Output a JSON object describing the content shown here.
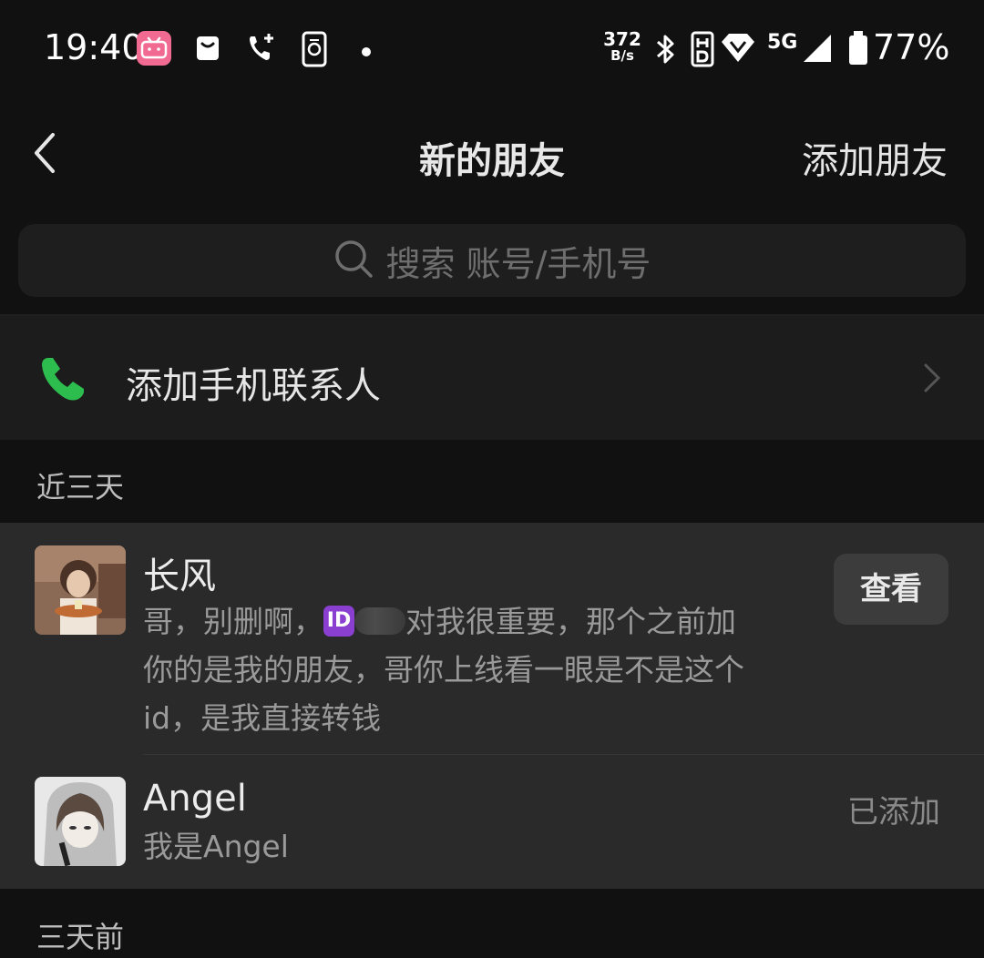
{
  "status_bar": {
    "time": "19:40",
    "apps": [
      "bilibili-icon",
      "shopping-bag-icon",
      "call-forward-icon",
      "phone-sync-icon"
    ],
    "net_speed_value": "372",
    "net_speed_unit": "B/s",
    "network": "5G",
    "battery": "77%"
  },
  "header": {
    "title": "新的朋友",
    "action": "添加朋友"
  },
  "search": {
    "placeholder": "搜索 账号/手机号"
  },
  "add_contacts": {
    "label": "添加手机联系人",
    "icon_color": "#2dbd4e"
  },
  "sections": {
    "recent": "近三天",
    "older": "三天前"
  },
  "requests": [
    {
      "name": "长风",
      "message_before": "哥，别删啊，",
      "badge": "ID",
      "message_after": "对我很重要，那个之前加你的是我的朋友，哥你上线看一眼是不是这个id，是我直接转钱",
      "action": "查看"
    },
    {
      "name": "Angel",
      "message": "我是Angel",
      "status": "已添加"
    }
  ]
}
